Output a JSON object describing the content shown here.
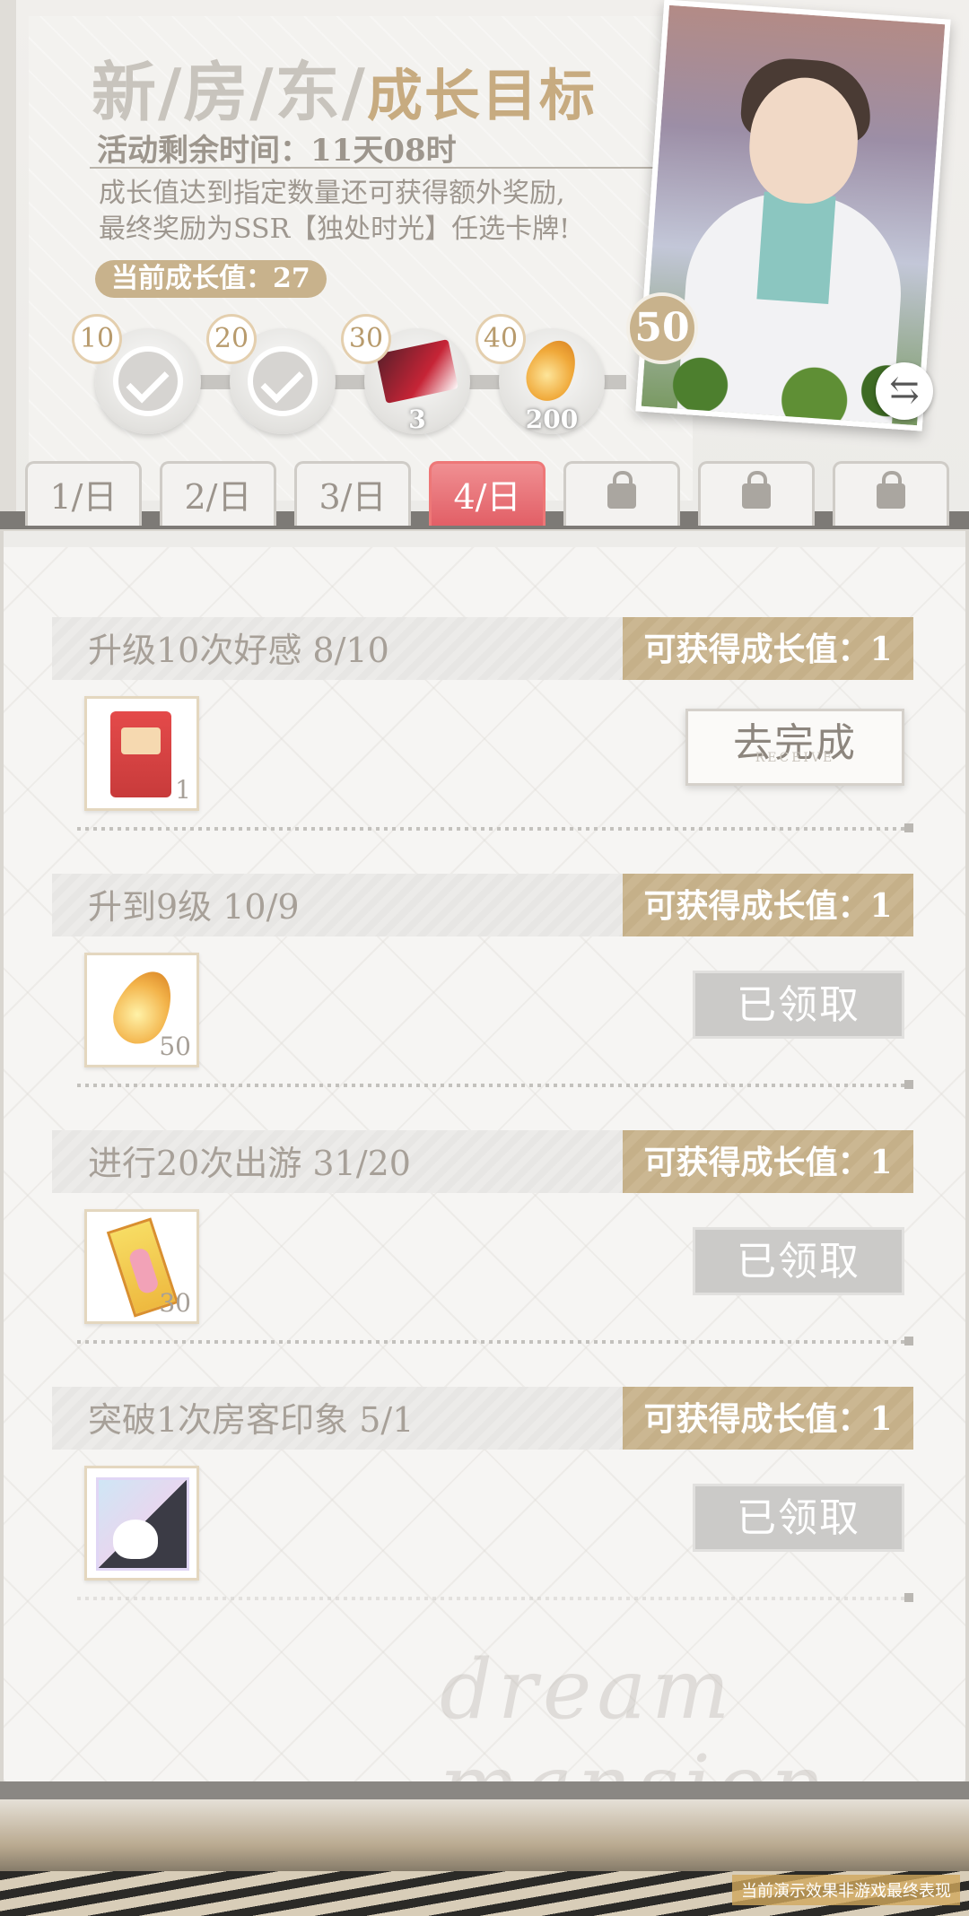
{
  "header": {
    "title_main": "新/房/东/",
    "title_sub": "成长目标",
    "timer": "活动剩余时间：11天08时",
    "description_line1": "成长值达到指定数量还可获得额外奖励,",
    "description_line2": "最终奖励为SSR【独处时光】任选卡牌!",
    "current_growth": "当前成长值：27"
  },
  "milestones": [
    {
      "threshold": "10",
      "claimed": true
    },
    {
      "threshold": "20",
      "claimed": true
    },
    {
      "threshold": "30",
      "claimed": false,
      "reward_count": "3",
      "reward_icon": "ticket-card-icon"
    },
    {
      "threshold": "40",
      "claimed": false,
      "reward_count": "200",
      "reward_icon": "amber-drop-icon"
    }
  ],
  "final_milestone": "50",
  "swap_icon": "⇆",
  "tabs": [
    {
      "label": "1/日",
      "locked": false,
      "active": false
    },
    {
      "label": "2/日",
      "locked": false,
      "active": false
    },
    {
      "label": "3/日",
      "locked": false,
      "active": false
    },
    {
      "label": "4/日",
      "locked": false,
      "active": true
    },
    {
      "label": "",
      "locked": true,
      "active": false
    },
    {
      "label": "",
      "locked": true,
      "active": false
    },
    {
      "label": "",
      "locked": true,
      "active": false
    }
  ],
  "tasks": [
    {
      "title": "升级10次好感 8/10",
      "reward": "可获得成长值：1",
      "item_icon": "snack-bag-icon",
      "item_qty": "1",
      "button": "去完成",
      "state": "go"
    },
    {
      "title": "升到9级 10/9",
      "reward": "可获得成长值：1",
      "item_icon": "amber-drop-icon",
      "item_qty": "50",
      "button": "已领取",
      "state": "done"
    },
    {
      "title": "进行20次出游 31/20",
      "reward": "可获得成长值：1",
      "item_icon": "bookmark-tag-icon",
      "item_qty": "30",
      "button": "已领取",
      "state": "done"
    },
    {
      "title": "突破1次房客印象 5/1",
      "reward": "可获得成长值：1",
      "item_icon": "cat-photo-icon",
      "item_qty": "",
      "button": "已领取",
      "state": "done"
    }
  ],
  "watermark": "dream mansion",
  "footer_note": "当前演示效果非游戏最终表现",
  "colors": {
    "accent_gold": "#c8b28c",
    "active_tab": "#e25f66",
    "done_button": "#cbcac8"
  }
}
